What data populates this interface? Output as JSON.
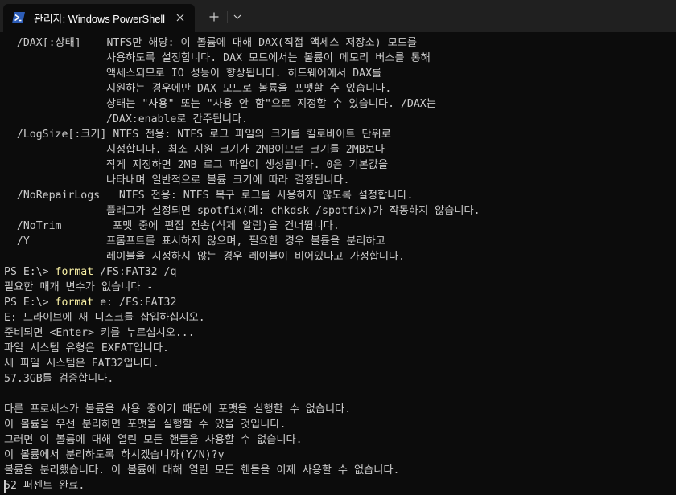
{
  "window": {
    "tab_title": "관리자: Windows PowerShell",
    "icon": "powershell-icon",
    "close_icon": "close-icon",
    "new_tab_icon": "plus-icon",
    "dropdown_icon": "chevron-down-icon"
  },
  "colors": {
    "background": "#0c0c0c",
    "titlebar": "#202020",
    "text": "#cccccc",
    "command": "#f9f1a5",
    "icon_blue": "#2d5db8"
  },
  "terminal": {
    "lines": [
      {
        "text": "  /DAX[:상태]    NTFS만 해당: 이 볼륨에 대해 DAX(직접 액세스 저장소) 모드를"
      },
      {
        "text": "                사용하도록 설정합니다. DAX 모드에서는 볼륨이 메모리 버스를 통해"
      },
      {
        "text": "                액세스되므로 IO 성능이 향상됩니다. 하드웨어에서 DAX를"
      },
      {
        "text": "                지원하는 경우에만 DAX 모드로 볼륨을 포맷할 수 있습니다."
      },
      {
        "text": "                상태는 \"사용\" 또는 \"사용 안 함\"으로 지정할 수 있습니다. /DAX는"
      },
      {
        "text": "                /DAX:enable로 간주됩니다."
      },
      {
        "text": "  /LogSize[:크기] NTFS 전용: NTFS 로그 파일의 크기를 킬로바이트 단위로"
      },
      {
        "text": "                지정합니다. 최소 지원 크기가 2MB이므로 크기를 2MB보다"
      },
      {
        "text": "                작게 지정하면 2MB 로그 파일이 생성됩니다. 0은 기본값을"
      },
      {
        "text": "                나타내며 일반적으로 볼륨 크기에 따라 결정됩니다."
      },
      {
        "text": "  /NoRepairLogs   NTFS 전용: NTFS 복구 로그를 사용하지 않도록 설정합니다."
      },
      {
        "text": "                플래그가 설정되면 spotfix(예: chkdsk /spotfix)가 작동하지 않습니다."
      },
      {
        "text": "  /NoTrim        포맷 중에 편집 전송(삭제 알림)을 건너뜁니다."
      },
      {
        "text": "  /Y            프롬프트를 표시하지 않으며, 필요한 경우 볼륨을 분리하고"
      },
      {
        "text": "                레이블을 지정하지 않는 경우 레이블이 비어있다고 가정합니다."
      },
      {
        "prompt": "PS E:\\> ",
        "cmd": "format",
        "args": " /FS:FAT32 /q"
      },
      {
        "text": "필요한 매개 변수가 없습니다 -"
      },
      {
        "prompt": "PS E:\\> ",
        "cmd": "format",
        "args": " e: /FS:FAT32"
      },
      {
        "text": "E: 드라이브에 새 디스크를 삽입하십시오."
      },
      {
        "text": "준비되면 <Enter> 키를 누르십시오..."
      },
      {
        "text": "파일 시스템 유형은 EXFAT입니다."
      },
      {
        "text": "새 파일 시스템은 FAT32입니다."
      },
      {
        "text": "57.3GB를 검증합니다."
      },
      {
        "text": ""
      },
      {
        "text": "다른 프로세스가 볼륨을 사용 중이기 때문에 포맷을 실행할 수 없습니다."
      },
      {
        "text": "이 볼륨을 우선 분리하면 포맷을 실행할 수 있을 것입니다."
      },
      {
        "text": "그러면 이 볼륨에 대해 열린 모든 핸들을 사용할 수 없습니다."
      },
      {
        "text": "이 볼륨에서 분리하도록 하시겠습니까(Y/N)?y"
      },
      {
        "text": "볼륨을 분리했습니다. 이 볼륨에 대해 열린 모든 핸들을 이제 사용할 수 없습니다."
      },
      {
        "text": "52 퍼센트 완료."
      }
    ]
  }
}
